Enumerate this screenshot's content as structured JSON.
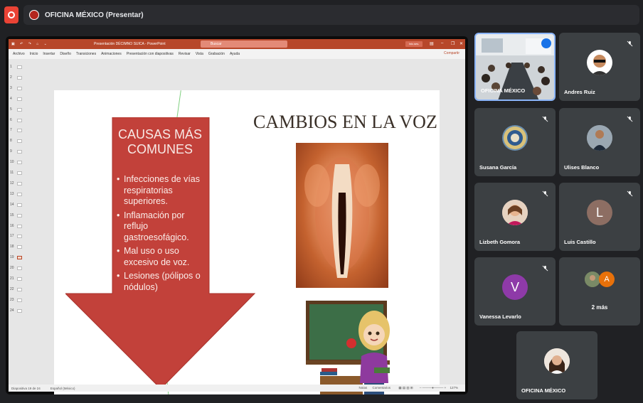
{
  "meeting": {
    "title": "OFICINA MÉXICO (Presentar)"
  },
  "powerpoint": {
    "window_title": "Presentación DÉCIMNO SUICA  -  PowerPoint",
    "search_placeholder": "Buscar",
    "sign_in": "Inic.ses.",
    "share": "Compartir",
    "ribbon_tabs": [
      "Archivo",
      "Inicio",
      "Insertar",
      "Diseño",
      "Transiciones",
      "Animaciones",
      "Presentación con diapositivas",
      "Revisar",
      "Vista",
      "Grabación",
      "Ayuda"
    ],
    "thumbnails": [
      "1",
      "2",
      "3",
      "4",
      "5",
      "6",
      "7",
      "8",
      "9",
      "10",
      "11",
      "12",
      "13",
      "14",
      "15",
      "16",
      "17",
      "18",
      "19",
      "20",
      "21",
      "22",
      "23",
      "24"
    ],
    "active_thumbnail": 19,
    "status_slide": "Diapositiva 19 de 24",
    "status_language": "Español (México)",
    "status_notes": "Notas",
    "status_comments": "Comentarios",
    "zoom": "127%"
  },
  "slide": {
    "arrow_title": "CAUSAS MÁS COMUNES",
    "bullets": [
      "Infecciones de vías respiratorias superiores.",
      "Inflamación por reflujo gastroesofágico.",
      "Mal uso o uso excesivo de voz.",
      "Lesiones (pólipos o nódulos)"
    ],
    "title": "CAMBIOS EN LA VOZ"
  },
  "participants": [
    {
      "name": "OFICINA MÉXICO",
      "avatar": "",
      "muted": false,
      "speaking": true
    },
    {
      "name": "Andres Ruiz",
      "avatar": "",
      "muted": true
    },
    {
      "name": "Susana García",
      "avatar": "",
      "muted": true
    },
    {
      "name": "Ulises Blanco",
      "avatar": "",
      "muted": true
    },
    {
      "name": "Lizbeth Gomora",
      "avatar": "",
      "muted": true
    },
    {
      "name": "Luis Castillo",
      "avatar": "L",
      "muted": true,
      "color": "#8d6e63"
    },
    {
      "name": "Vanessa Levarlo",
      "avatar": "V",
      "muted": true,
      "color": "#8e3aa8"
    },
    {
      "name": "2 más",
      "avatar": "A",
      "muted": false,
      "color": "#e8710a"
    },
    {
      "name": "OFICINA MÉXICO",
      "avatar": "",
      "muted": false
    }
  ],
  "colors": {
    "accent_blue": "#8ab4f8",
    "arrow_red": "#c2413a",
    "powerpoint_orange": "#b7472a"
  }
}
